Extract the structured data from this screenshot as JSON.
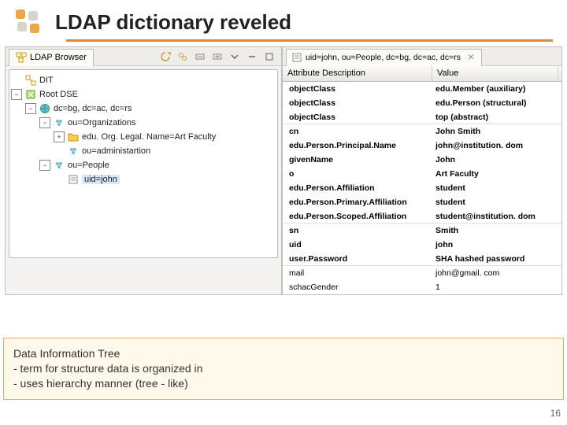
{
  "header": {
    "title": "LDAP dictionary reveled"
  },
  "slide": {
    "number": "16"
  },
  "browser": {
    "tabLabel": "LDAP Browser",
    "tree": {
      "root": "DIT",
      "rootdse": "Root DSE",
      "dc": "dc=bg, dc=ac, dc=rs",
      "orgs": "ou=Organizations",
      "art": "edu. Org. Legal. Name=Art Faculty",
      "admin": "ou=administartion",
      "people": "ou=People",
      "uidjohn": "uid=john"
    }
  },
  "entry": {
    "breadcrumb": "uid=john, ou=People, dc=bg, dc=ac, dc=rs",
    "headers": {
      "attr": "Attribute Description",
      "value": "Value"
    },
    "rows": [
      {
        "a": "objectClass",
        "v": "edu.Member (auxiliary)",
        "b": true,
        "sep": false
      },
      {
        "a": "objectClass",
        "v": "edu.Person (structural)",
        "b": true,
        "sep": false
      },
      {
        "a": "objectClass",
        "v": "top (abstract)",
        "b": true,
        "sep": true
      },
      {
        "a": "cn",
        "v": "John Smith",
        "b": true,
        "sep": false
      },
      {
        "a": "edu.Person.Principal.Name",
        "v": "john@institution. dom",
        "b": true,
        "sep": false
      },
      {
        "a": "givenName",
        "v": "John",
        "b": true,
        "sep": false
      },
      {
        "a": "o",
        "v": "Art Faculty",
        "b": true,
        "sep": false
      },
      {
        "a": "edu.Person.Affiliation",
        "v": "student",
        "b": true,
        "sep": false
      },
      {
        "a": "edu.Person.Primary.Affiliation",
        "v": "student",
        "b": true,
        "sep": false
      },
      {
        "a": "edu.Person.Scoped.Affiliation",
        "v": "student@institution. dom",
        "b": true,
        "sep": true
      },
      {
        "a": "sn",
        "v": "Smith",
        "b": true,
        "sep": false
      },
      {
        "a": "uid",
        "v": "john",
        "b": true,
        "sep": false
      },
      {
        "a": "user.Password",
        "v": "SHA hashed password",
        "b": true,
        "sep": true
      },
      {
        "a": "mail",
        "v": "john@gmail. com",
        "b": false,
        "sep": false
      },
      {
        "a": "schacGender",
        "v": "1",
        "b": false,
        "sep": false
      }
    ]
  },
  "info": {
    "heading": "Data Information Tree",
    "line1": " - term for structure data is organized in",
    "line2": " - uses hierarchy manner (tree - like)"
  }
}
